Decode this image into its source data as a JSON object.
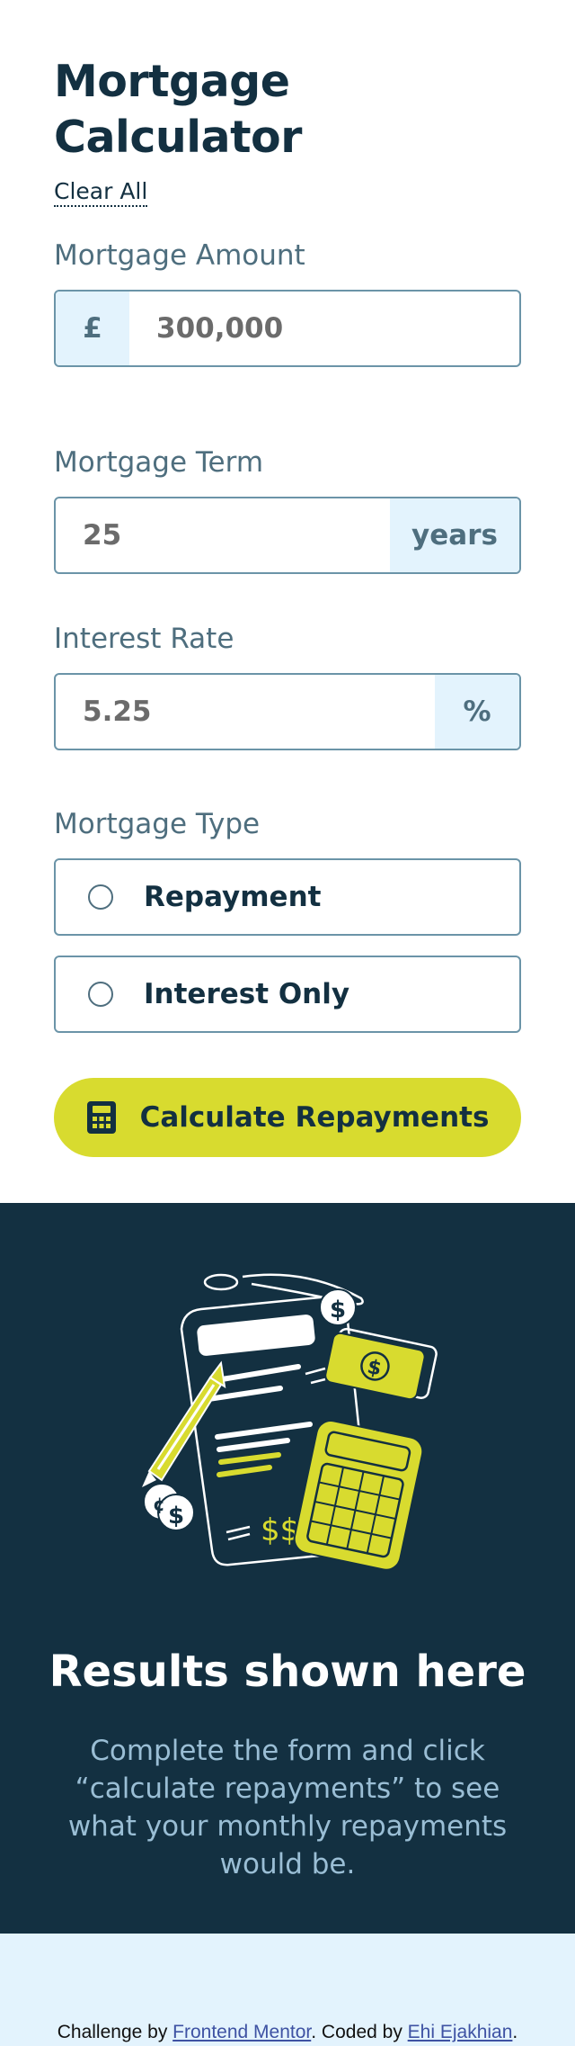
{
  "form": {
    "title": "Mortgage Calculator",
    "clear_all": "Clear All",
    "amount": {
      "label": "Mortgage Amount",
      "prefix": "£",
      "value": "300,000"
    },
    "term": {
      "label": "Mortgage Term",
      "value": "25",
      "suffix": "years"
    },
    "rate": {
      "label": "Interest Rate",
      "value": "5.25",
      "suffix": "%"
    },
    "type": {
      "label": "Mortgage Type",
      "options": [
        {
          "label": "Repayment",
          "selected": false
        },
        {
          "label": "Interest Only",
          "selected": false
        }
      ]
    },
    "submit_label": "Calculate Repayments",
    "submit_icon": "calculator-icon"
  },
  "results": {
    "illustration": "empty-results-illustration",
    "title": "Results shown here",
    "text": "Complete the form and click “calculate repayments” to see what your monthly repayments would be."
  },
  "footer": {
    "prefix": "Challenge by ",
    "challenge_link": "Frontend Mentor",
    "middle": ". Coded by ",
    "author_link": "Ehi Ejakhian",
    "suffix": "."
  },
  "colors": {
    "primary": "#133041",
    "lime": "#d8db2f",
    "slate": "#4e6e7e",
    "light_blue": "#e3f3fd",
    "border": "#6b94a8"
  }
}
